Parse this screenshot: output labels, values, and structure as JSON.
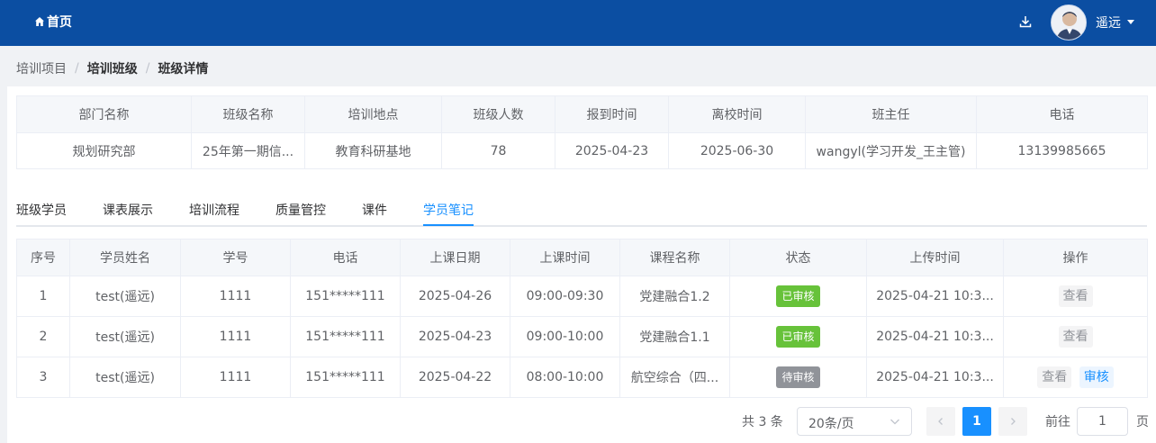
{
  "navbar": {
    "home_label": "首页",
    "user_name": "遥远"
  },
  "breadcrumb": {
    "items": [
      "培训项目",
      "培训班级",
      "班级详情"
    ],
    "separator": "/"
  },
  "class_info": {
    "headers": [
      "部门名称",
      "班级名称",
      "培训地点",
      "班级人数",
      "报到时间",
      "离校时间",
      "班主任",
      "电话"
    ],
    "values": [
      "规划研究部",
      "25年第一期信...",
      "教育科研基地",
      "78",
      "2025-04-23",
      "2025-06-30",
      "wangyl(学习开发_王主管)",
      "13139985665"
    ]
  },
  "tabs": {
    "items": [
      "班级学员",
      "课表展示",
      "培训流程",
      "质量管控",
      "课件",
      "学员笔记"
    ],
    "active": "学员笔记"
  },
  "notes_table": {
    "headers": [
      "序号",
      "学员姓名",
      "学号",
      "电话",
      "上课日期",
      "上课时间",
      "课程名称",
      "状态",
      "上传时间",
      "操作"
    ],
    "rows": [
      {
        "index": "1",
        "name": "test(遥远)",
        "student_no": "1111",
        "phone": "151*****111",
        "date": "2025-04-26",
        "time": "09:00-09:30",
        "course": "党建融合1.2",
        "status": "已审核",
        "upload_time": "2025-04-21 10:3...",
        "view_label": "查看"
      },
      {
        "index": "2",
        "name": "test(遥远)",
        "student_no": "1111",
        "phone": "151*****111",
        "date": "2025-04-23",
        "time": "09:00-10:00",
        "course": "党建融合1.1",
        "status": "已审核",
        "upload_time": "2025-04-21 10:3...",
        "view_label": "查看"
      },
      {
        "index": "3",
        "name": "test(遥远)",
        "student_no": "1111",
        "phone": "151*****111",
        "date": "2025-04-22",
        "time": "08:00-10:00",
        "course": "航空综合（四...",
        "status": "待审核",
        "upload_time": "2025-04-21 10:3...",
        "view_label": "查看",
        "review_label": "审核"
      }
    ]
  },
  "pagination": {
    "total_text": "共 3 条",
    "page_size": "20条/页",
    "current_page": "1",
    "goto_label": "前往",
    "goto_value": "1",
    "page_suffix": "页"
  },
  "colors": {
    "nav_bg": "#0b4ea2",
    "primary": "#1890ff",
    "approved": "#67c23a",
    "pending": "#909399"
  },
  "icons": {
    "home": "home-icon",
    "download": "download-icon",
    "caret": "caret-down-icon",
    "prev": "chevron-left-icon",
    "next": "chevron-right-icon"
  }
}
